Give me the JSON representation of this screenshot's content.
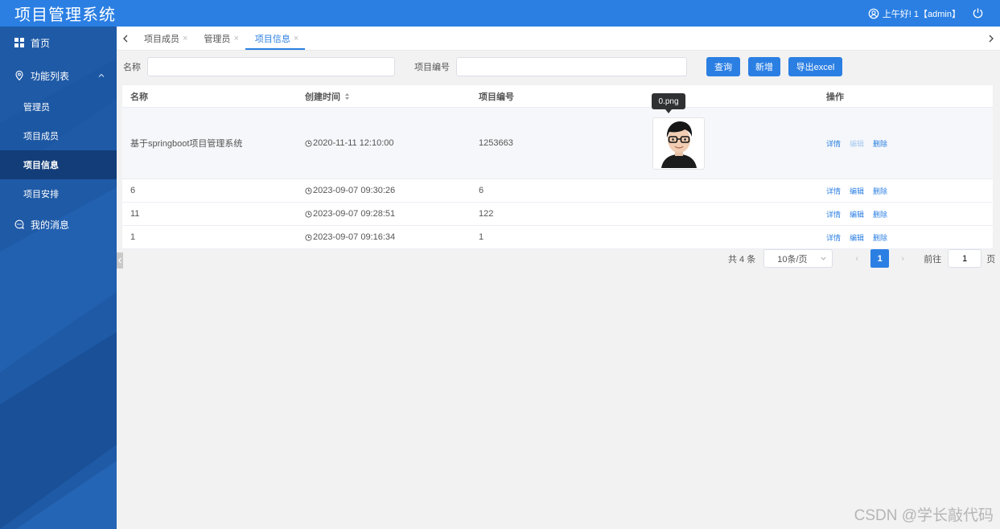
{
  "header": {
    "title": "项目管理系统",
    "greeting": "上午好! 1【admin】",
    "icons": [
      "user-icon",
      "power-icon"
    ]
  },
  "sidebar": {
    "items": [
      {
        "label": "首页",
        "icon": "grid-icon"
      },
      {
        "label": "功能列表",
        "icon": "location-pin-icon",
        "expanded": true
      },
      {
        "label": "管理员"
      },
      {
        "label": "项目成员"
      },
      {
        "label": "项目信息",
        "active": true
      },
      {
        "label": "项目安排"
      },
      {
        "label": "我的消息",
        "icon": "message-icon"
      }
    ]
  },
  "tabs": [
    {
      "label": "项目成员",
      "close": "×"
    },
    {
      "label": "管理员",
      "close": "×"
    },
    {
      "label": "项目信息",
      "close": "×",
      "active": true
    }
  ],
  "search": {
    "name_label": "名称",
    "name_value": "",
    "code_label": "项目编号",
    "code_value": "",
    "query_button": "查询",
    "add_button": "新增",
    "export_button": "导出excel"
  },
  "table": {
    "columns": [
      "名称",
      "创建时间",
      "项目编号",
      "",
      "操作"
    ],
    "rows": [
      {
        "name": "基于springboot项目管理系统",
        "time": "2020-11-11 12:10:00",
        "code": "1253663",
        "has_image": true
      },
      {
        "name": "6",
        "time": "2023-09-07 09:30:26",
        "code": "6"
      },
      {
        "name": "11",
        "time": "2023-09-07 09:28:51",
        "code": "122"
      },
      {
        "name": "1",
        "time": "2023-09-07 09:16:34",
        "code": "1"
      }
    ],
    "actions": {
      "detail": "详情",
      "edit": "编辑",
      "delete": "删除"
    },
    "tooltip": "0.png"
  },
  "pagination": {
    "total": "共 4 条",
    "page_size": "10条/页",
    "prev": "‹",
    "current": "1",
    "next": "›",
    "goto_label": "前往",
    "goto_value": "1",
    "page_suffix": "页"
  },
  "watermark": "CSDN @学长敲代码",
  "colors": {
    "primary": "#2b7fe3",
    "sidebar": "#1f5aa6",
    "sidebar_active": "#123d78"
  }
}
